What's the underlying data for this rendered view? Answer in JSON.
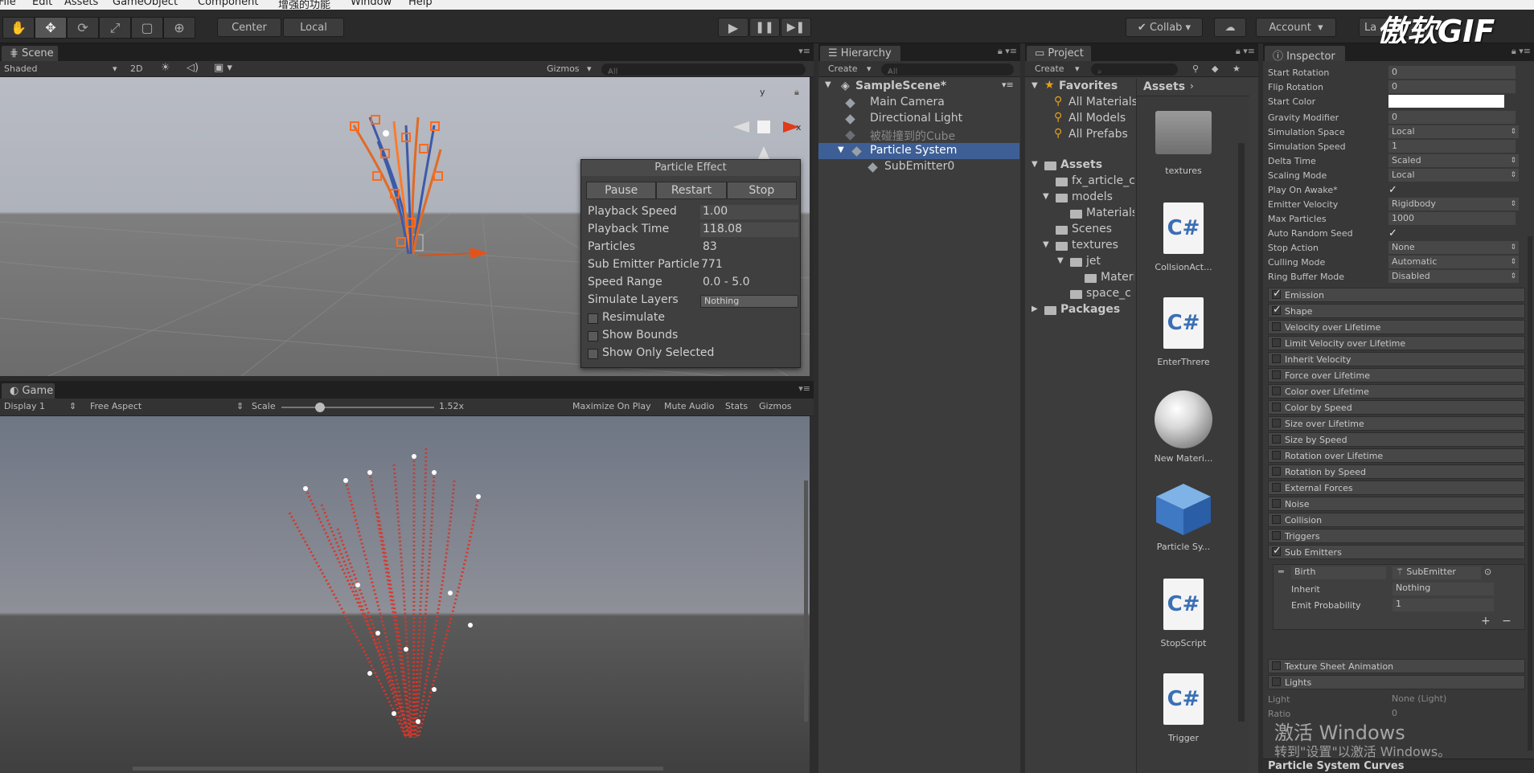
{
  "menu": [
    "File",
    "Edit",
    "Assets",
    "GameObject",
    "Component",
    "增强的功能",
    "Window",
    "Help"
  ],
  "toolbar": {
    "pivot": "Center",
    "space": "Local",
    "collab": "Collab",
    "account": "Account",
    "layers": "La",
    "watermark": "傲软GIF"
  },
  "scene": {
    "tab": "Scene",
    "shading": "Shaded",
    "mode2d": "2D",
    "gizmos": "Gizmos",
    "search": "All",
    "gizmo_y": "y",
    "gizmo_x": "x"
  },
  "particle_effect": {
    "title": "Particle Effect",
    "buttons": [
      "Pause",
      "Restart",
      "Stop"
    ],
    "playback_speed_label": "Playback Speed",
    "playback_speed": "1.00",
    "playback_time_label": "Playback Time",
    "playback_time": "118.08",
    "particles_label": "Particles",
    "particles": "83",
    "sub_emitter_label": "Sub Emitter Particle",
    "sub_emitter": "771",
    "speed_range_label": "Speed Range",
    "speed_range": "0.0 - 5.0",
    "simulate_layers_label": "Simulate Layers",
    "simulate_layers": "Nothing",
    "resimulate": "Resimulate",
    "show_bounds": "Show Bounds",
    "show_only_selected": "Show Only Selected"
  },
  "game": {
    "tab": "Game",
    "display": "Display 1",
    "aspect": "Free Aspect",
    "scale_label": "Scale",
    "scale": "1.52x",
    "maximize": "Maximize On Play",
    "mute": "Mute Audio",
    "stats": "Stats",
    "gizmos": "Gizmos"
  },
  "hierarchy": {
    "tab": "Hierarchy",
    "create": "Create",
    "search": "All",
    "scene": "SampleScene*",
    "items": [
      "Main Camera",
      "Directional Light",
      "被碰撞到的Cube",
      "Particle System",
      "SubEmitter0"
    ]
  },
  "project": {
    "tab": "Project",
    "create": "Create",
    "favorites": "Favorites",
    "fav_items": [
      "All Materials",
      "All Models",
      "All Prefabs"
    ],
    "assets": "Assets",
    "tree": [
      "fx_article_c",
      "models",
      "Materials",
      "Scenes",
      "textures",
      "jet",
      "Materi",
      "space_c"
    ],
    "packages": "Packages",
    "breadcrumb": "Assets",
    "grid": [
      "textures",
      "CollsionAct...",
      "EnterThrere",
      "New Materi...",
      "Particle Sy...",
      "StopScript",
      "Trigger"
    ],
    "cs_glyph": "C#"
  },
  "inspector": {
    "tab": "Inspector",
    "rows": [
      {
        "label": "Start Rotation",
        "value": "0"
      },
      {
        "label": "Flip Rotation",
        "value": "0"
      },
      {
        "label": "Start Color",
        "value": ""
      },
      {
        "label": "Gravity Modifier",
        "value": "0"
      },
      {
        "label": "Simulation Space",
        "value": "Local"
      },
      {
        "label": "Simulation Speed",
        "value": "1"
      },
      {
        "label": "Delta Time",
        "value": "Scaled"
      },
      {
        "label": "Scaling Mode",
        "value": "Local"
      },
      {
        "label": "Play On Awake*",
        "value": ""
      },
      {
        "label": "Emitter Velocity",
        "value": "Rigidbody"
      },
      {
        "label": "Max Particles",
        "value": "1000"
      },
      {
        "label": "Auto Random Seed",
        "value": ""
      },
      {
        "label": "Stop Action",
        "value": "None"
      },
      {
        "label": "Culling Mode",
        "value": "Automatic"
      },
      {
        "label": "Ring Buffer Mode",
        "value": "Disabled"
      }
    ],
    "modules": [
      {
        "name": "Emission",
        "on": true
      },
      {
        "name": "Shape",
        "on": true
      },
      {
        "name": "Velocity over Lifetime",
        "on": false
      },
      {
        "name": "Limit Velocity over Lifetime",
        "on": false
      },
      {
        "name": "Inherit Velocity",
        "on": false
      },
      {
        "name": "Force over Lifetime",
        "on": false
      },
      {
        "name": "Color over Lifetime",
        "on": false
      },
      {
        "name": "Color by Speed",
        "on": false
      },
      {
        "name": "Size over Lifetime",
        "on": false
      },
      {
        "name": "Size by Speed",
        "on": false
      },
      {
        "name": "Rotation over Lifetime",
        "on": false
      },
      {
        "name": "Rotation by Speed",
        "on": false
      },
      {
        "name": "External Forces",
        "on": false
      },
      {
        "name": "Noise",
        "on": false
      },
      {
        "name": "Collision",
        "on": false
      },
      {
        "name": "Triggers",
        "on": false
      },
      {
        "name": "Sub Emitters",
        "on": true
      }
    ],
    "sub_emitter": {
      "type": "Birth",
      "object": "SubEmitter",
      "inherit_label": "Inherit",
      "inherit": "Nothing",
      "prob_label": "Emit Probability",
      "prob": "1"
    },
    "modules2": [
      {
        "name": "Texture Sheet Animation",
        "on": false
      },
      {
        "name": "Lights",
        "on": false
      }
    ],
    "lights": {
      "light_label": "Light",
      "light": "None (Light)",
      "ratio_label": "Ratio",
      "ratio": "0"
    },
    "curves": "Particle System Curves",
    "activate_line1": "激活 Windows",
    "activate_line2": "转到\"设置\"以激活 Windows。"
  },
  "colors": {
    "selection": "#3e5f96",
    "particle_scene": "#ff6a1a",
    "particle_game": "#d9362b"
  }
}
